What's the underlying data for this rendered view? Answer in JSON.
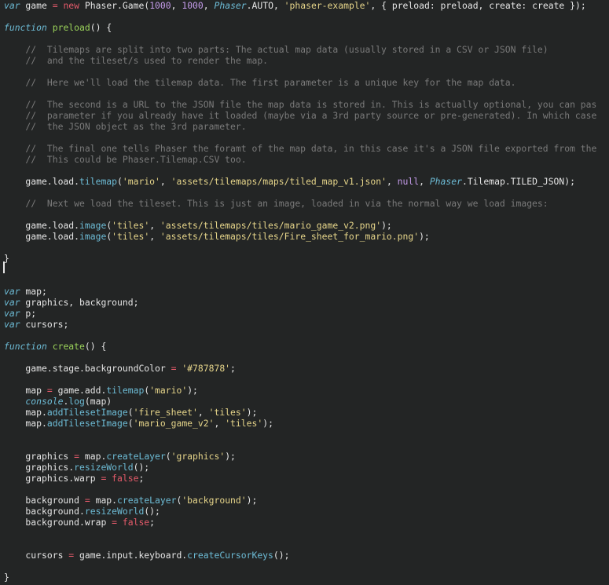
{
  "editor": {
    "background": "#232525",
    "colors": {
      "keyword": "#6dbcd6",
      "operator": "#e45a6a",
      "number": "#c49bea",
      "string": "#e6d58a",
      "comment": "#7a7a7a",
      "function_name": "#9bd35a",
      "text": "#e6e6e6"
    },
    "lines": [
      [
        [
          "kw",
          "var"
        ],
        [
          "id",
          " game "
        ],
        [
          "op",
          "="
        ],
        [
          "id",
          " "
        ],
        [
          "new",
          "new"
        ],
        [
          "id",
          " Phaser.Game("
        ],
        [
          "num",
          "1000"
        ],
        [
          "pun",
          ", "
        ],
        [
          "num",
          "1000"
        ],
        [
          "pun",
          ", "
        ],
        [
          "cls",
          "Phaser"
        ],
        [
          "id",
          ".AUTO, "
        ],
        [
          "str",
          "'phaser-example'"
        ],
        [
          "pun",
          ", { preload: preload, create: create });"
        ]
      ],
      [],
      [
        [
          "kw",
          "function"
        ],
        [
          "id",
          " "
        ],
        [
          "fnname",
          "preload"
        ],
        [
          "pun",
          "() {"
        ]
      ],
      [],
      [
        [
          "cm",
          "    //  Tilemaps are split into two parts: The actual map data (usually stored in a CSV or JSON file)"
        ]
      ],
      [
        [
          "cm",
          "    //  and the tileset/s used to render the map."
        ]
      ],
      [],
      [
        [
          "cm",
          "    //  Here we'll load the tilemap data. The first parameter is a unique key for the map data."
        ]
      ],
      [],
      [
        [
          "cm",
          "    //  The second is a URL to the JSON file the map data is stored in. This is actually optional, you can pas"
        ]
      ],
      [
        [
          "cm",
          "    //  parameter if you already have it loaded (maybe via a 3rd party source or pre-generated). In which case"
        ]
      ],
      [
        [
          "cm",
          "    //  the JSON object as the 3rd parameter."
        ]
      ],
      [],
      [
        [
          "cm",
          "    //  The final one tells Phaser the foramt of the map data, in this case it's a JSON file exported from the"
        ]
      ],
      [
        [
          "cm",
          "    //  This could be Phaser.Tilemap.CSV too."
        ]
      ],
      [],
      [
        [
          "id",
          "    game.load."
        ],
        [
          "fn",
          "tilemap"
        ],
        [
          "pun",
          "("
        ],
        [
          "str",
          "'mario'"
        ],
        [
          "pun",
          ", "
        ],
        [
          "str",
          "'assets/tilemaps/maps/tiled_map_v1.json'"
        ],
        [
          "pun",
          ", "
        ],
        [
          "num",
          "null"
        ],
        [
          "pun",
          ", "
        ],
        [
          "cls",
          "Phaser"
        ],
        [
          "id",
          ".Tilemap.TILED_JSON);"
        ]
      ],
      [],
      [
        [
          "cm",
          "    //  Next we load the tileset. This is just an image, loaded in via the normal way we load images:"
        ]
      ],
      [],
      [
        [
          "id",
          "    game.load."
        ],
        [
          "fn",
          "image"
        ],
        [
          "pun",
          "("
        ],
        [
          "str",
          "'tiles'"
        ],
        [
          "pun",
          ", "
        ],
        [
          "str",
          "'assets/tilemaps/tiles/mario_game_v2.png'"
        ],
        [
          "pun",
          ");"
        ]
      ],
      [
        [
          "id",
          "    game.load."
        ],
        [
          "fn",
          "image"
        ],
        [
          "pun",
          "("
        ],
        [
          "str",
          "'tiles'"
        ],
        [
          "pun",
          ", "
        ],
        [
          "str",
          "'assets/tilemaps/tiles/Fire_sheet_for_mario.png'"
        ],
        [
          "pun",
          ");"
        ]
      ],
      [],
      [
        [
          "pun",
          "}"
        ]
      ],
      [],
      [],
      [
        [
          "kw",
          "var"
        ],
        [
          "id",
          " map;"
        ]
      ],
      [
        [
          "kw",
          "var"
        ],
        [
          "id",
          " graphics, background;"
        ]
      ],
      [
        [
          "kw",
          "var"
        ],
        [
          "id",
          " p;"
        ]
      ],
      [
        [
          "kw",
          "var"
        ],
        [
          "id",
          " cursors;"
        ]
      ],
      [],
      [
        [
          "kw",
          "function"
        ],
        [
          "id",
          " "
        ],
        [
          "fnname",
          "create"
        ],
        [
          "pun",
          "() {"
        ]
      ],
      [],
      [
        [
          "id",
          "    game.stage.backgroundColor "
        ],
        [
          "op",
          "="
        ],
        [
          "id",
          " "
        ],
        [
          "str",
          "'#787878'"
        ],
        [
          "pun",
          ";"
        ]
      ],
      [],
      [
        [
          "id",
          "    map "
        ],
        [
          "op",
          "="
        ],
        [
          "id",
          " game.add."
        ],
        [
          "fn",
          "tilemap"
        ],
        [
          "pun",
          "("
        ],
        [
          "str",
          "'mario'"
        ],
        [
          "pun",
          ");"
        ]
      ],
      [
        [
          "cls",
          "    console"
        ],
        [
          "pun",
          "."
        ],
        [
          "fn",
          "log"
        ],
        [
          "pun",
          "(map)"
        ]
      ],
      [
        [
          "id",
          "    map."
        ],
        [
          "fn",
          "addTilesetImage"
        ],
        [
          "pun",
          "("
        ],
        [
          "str",
          "'fire_sheet'"
        ],
        [
          "pun",
          ", "
        ],
        [
          "str",
          "'tiles'"
        ],
        [
          "pun",
          ");"
        ]
      ],
      [
        [
          "id",
          "    map."
        ],
        [
          "fn",
          "addTilesetImage"
        ],
        [
          "pun",
          "("
        ],
        [
          "str",
          "'mario_game_v2'"
        ],
        [
          "pun",
          ", "
        ],
        [
          "str",
          "'tiles'"
        ],
        [
          "pun",
          ");"
        ]
      ],
      [],
      [],
      [
        [
          "id",
          "    graphics "
        ],
        [
          "op",
          "="
        ],
        [
          "id",
          " map."
        ],
        [
          "fn",
          "createLayer"
        ],
        [
          "pun",
          "("
        ],
        [
          "str",
          "'graphics'"
        ],
        [
          "pun",
          ");"
        ]
      ],
      [
        [
          "id",
          "    graphics."
        ],
        [
          "fn",
          "resizeWorld"
        ],
        [
          "pun",
          "();"
        ]
      ],
      [
        [
          "id",
          "    graphics.warp "
        ],
        [
          "op",
          "="
        ],
        [
          "id",
          " "
        ],
        [
          "bool",
          "false"
        ],
        [
          "pun",
          ";"
        ]
      ],
      [],
      [
        [
          "id",
          "    background "
        ],
        [
          "op",
          "="
        ],
        [
          "id",
          " map."
        ],
        [
          "fn",
          "createLayer"
        ],
        [
          "pun",
          "("
        ],
        [
          "str",
          "'background'"
        ],
        [
          "pun",
          ");"
        ]
      ],
      [
        [
          "id",
          "    background."
        ],
        [
          "fn",
          "resizeWorld"
        ],
        [
          "pun",
          "();"
        ]
      ],
      [
        [
          "id",
          "    background.wrap "
        ],
        [
          "op",
          "="
        ],
        [
          "id",
          " "
        ],
        [
          "bool",
          "false"
        ],
        [
          "pun",
          ";"
        ]
      ],
      [],
      [],
      [
        [
          "id",
          "    cursors "
        ],
        [
          "op",
          "="
        ],
        [
          "id",
          " game.input.keyboard."
        ],
        [
          "fn",
          "createCursorKeys"
        ],
        [
          "pun",
          "();"
        ]
      ],
      [],
      [
        [
          "pun",
          "}"
        ]
      ]
    ]
  }
}
